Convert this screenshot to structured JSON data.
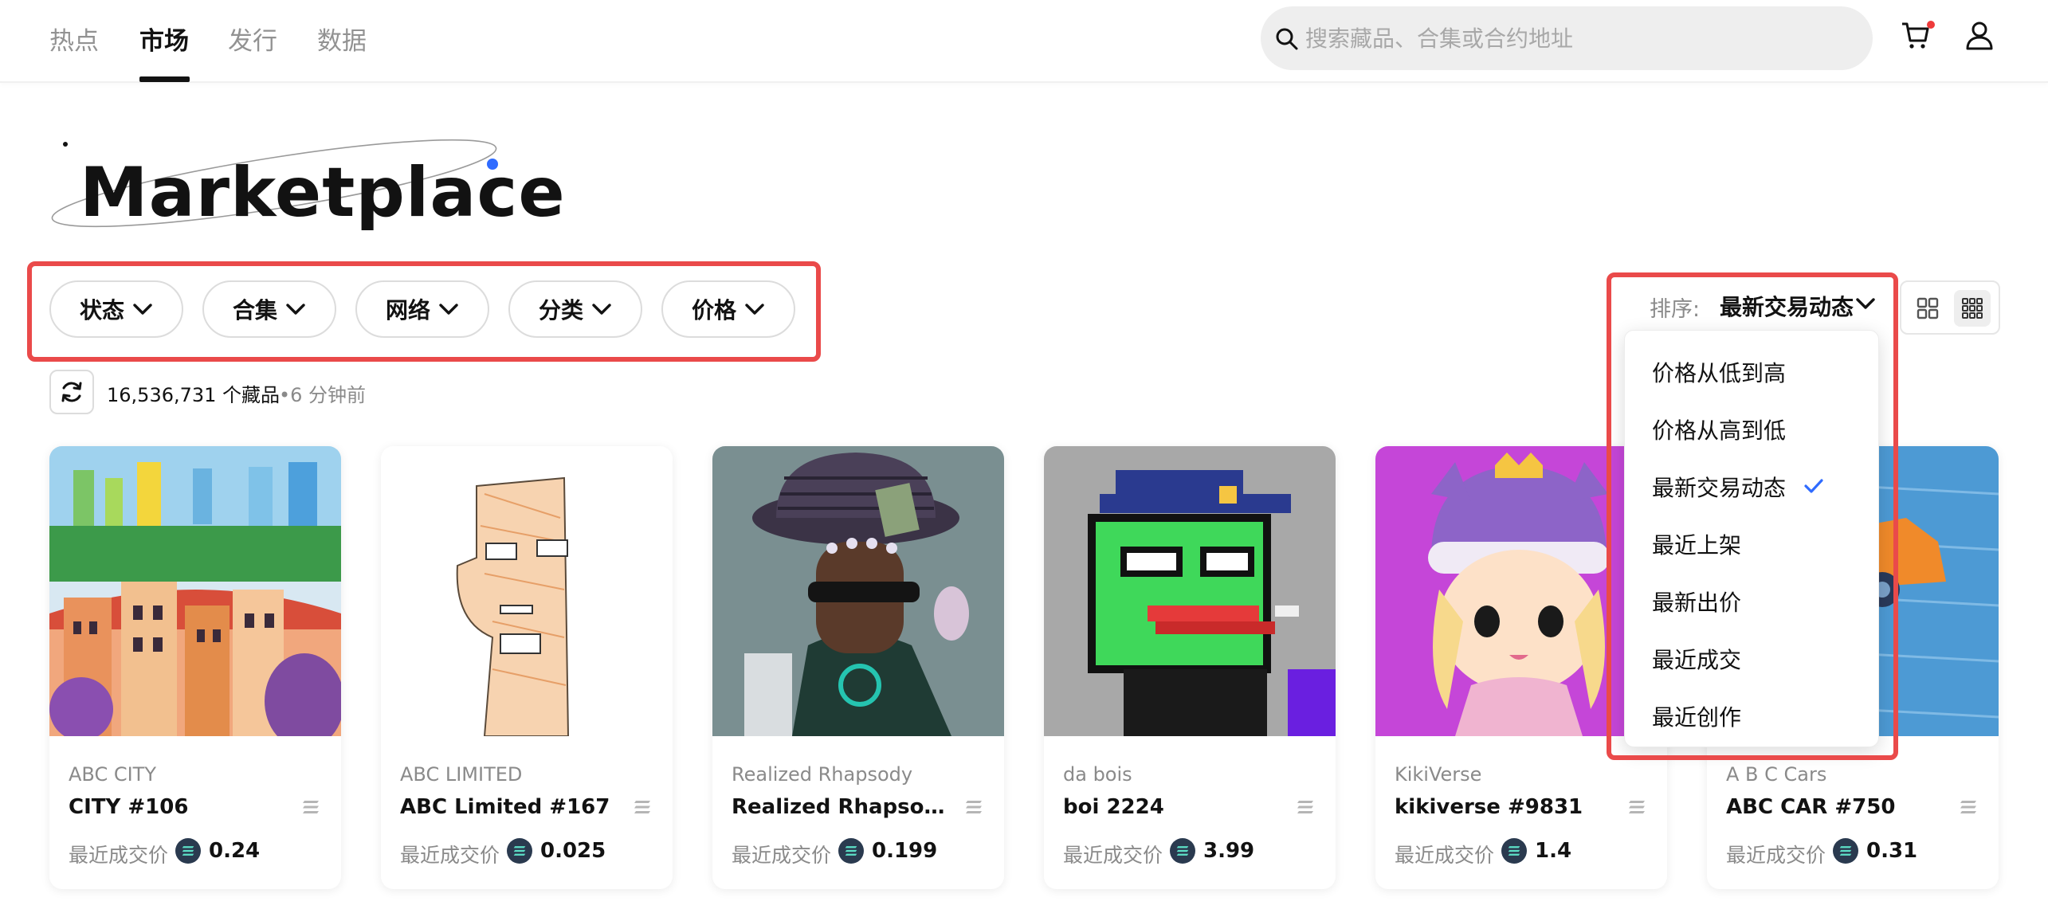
{
  "nav": {
    "tabs": [
      "热点",
      "市场",
      "发行",
      "数据"
    ],
    "active_tab": "市场"
  },
  "search": {
    "placeholder": "搜索藏品、合集或合约地址"
  },
  "header": {
    "cart_icon": "cart-icon",
    "user_icon": "user-icon"
  },
  "page": {
    "title": "Marketplace"
  },
  "filters": [
    "状态",
    "合集",
    "网络",
    "分类",
    "价格"
  ],
  "sort": {
    "label": "排序:",
    "selected": "最新交易动态",
    "options": [
      "价格从低到高",
      "价格从高到低",
      "最新交易动态",
      "最近上架",
      "最新出价",
      "最近成交",
      "最近创作"
    ]
  },
  "stats": {
    "count": "16,536,731 个藏品",
    "updated": "•6 分钟前"
  },
  "price_label": "最近成交价",
  "cards": [
    {
      "collection": "ABC CITY",
      "name": "CITY #106",
      "price": "0.24"
    },
    {
      "collection": "ABC LIMITED",
      "name": "ABC Limited #167",
      "price": "0.025"
    },
    {
      "collection": "Realized Rhapsody",
      "name": "Realized Rhapsody ...",
      "price": "0.199"
    },
    {
      "collection": "da bois",
      "name": "boi 2224",
      "price": "3.99"
    },
    {
      "collection": "KikiVerse",
      "name": "kikiverse #9831",
      "price": "1.4"
    },
    {
      "collection": "A B C Cars",
      "name": "ABC CAR #750",
      "price": "0.31"
    }
  ],
  "colors": {
    "accent_red": "#ea4a4a",
    "check_blue": "#2f6bff",
    "text": "#121212",
    "muted": "#8a8a8a"
  }
}
